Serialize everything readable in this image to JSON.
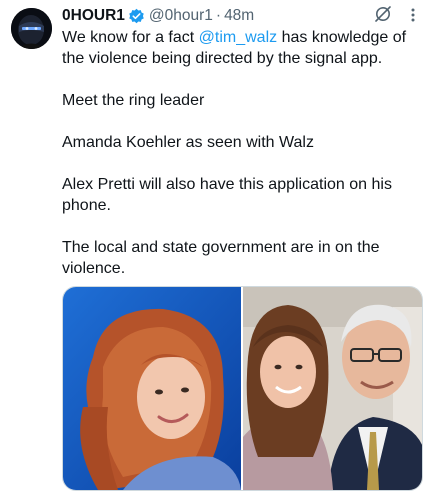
{
  "post": {
    "author": {
      "display_name": "0HOUR1",
      "handle": "@0hour1",
      "verified": true,
      "avatar_icon": "masked-figure-avatar"
    },
    "separator": "·",
    "timestamp": "48m",
    "text_part1_prefix": "We know for a fact ",
    "mention": "@tim_walz",
    "text_part1_suffix": " has knowledge of the violence being directed by the signal app.",
    "paragraphs": [
      "Meet the ring leader",
      "Amanda Koehler as seen with Walz",
      "Alex Pretti will also have this application on his phone.",
      "The local and state government are in on the violence."
    ],
    "media": [
      {
        "icon": "portrait-photo-red-haired-woman"
      },
      {
        "icon": "photo-woman-with-older-man"
      }
    ]
  },
  "colors": {
    "text": "#0f1419",
    "secondary": "#536471",
    "link": "#1d9bf0",
    "verified_badge": "#1d9bf0"
  }
}
